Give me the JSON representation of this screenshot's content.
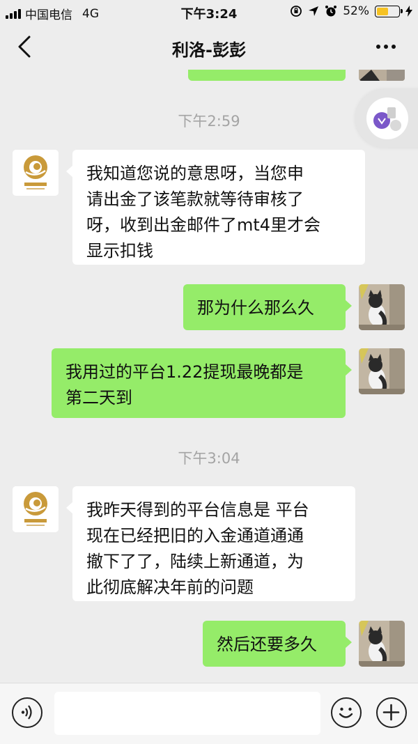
{
  "status_bar": {
    "carrier": "中国电信",
    "network": "4G",
    "time": "下午3:24",
    "battery": "52%",
    "battery_level": 0.52
  },
  "nav": {
    "title": "利洛-彭彭",
    "back_icon": "chevron-left-icon",
    "more_icon": "more-dots-icon"
  },
  "messages": [
    {
      "type": "timestamp",
      "text": "下午2:59"
    },
    {
      "type": "received",
      "sender": "contact",
      "lines": [
        "我知道您说的意思呀，当您申",
        "请出金了该笔款就等待审核了",
        "呀，收到出金邮件了mt4里才会",
        "显示扣钱"
      ]
    },
    {
      "type": "sent",
      "sender": "me",
      "lines": [
        "那为什么那么久"
      ]
    },
    {
      "type": "sent",
      "sender": "me",
      "lines": [
        "我用过的平台1.22提现最晚都是",
        "第二天到"
      ]
    },
    {
      "type": "timestamp",
      "text": "下午3:04"
    },
    {
      "type": "received",
      "sender": "contact",
      "lines": [
        "我昨天得到的平台信息是 平台",
        "现在已经把旧的入金通道通通",
        "撤下了了，陆续上新通道，为",
        "此彻底解决年前的问题"
      ]
    },
    {
      "type": "sent",
      "sender": "me",
      "lines": [
        "然后还要多久"
      ]
    }
  ],
  "input_bar": {
    "voice_icon": "voice-icon",
    "input_value": "",
    "emoji_icon": "emoji-icon",
    "plus_icon": "plus-icon"
  },
  "colors": {
    "background": "#ededed",
    "sent_bubble": "#95ec69",
    "received_bubble": "#ffffff",
    "battery": "#f6c223",
    "timestamp": "#a4a4a4"
  }
}
